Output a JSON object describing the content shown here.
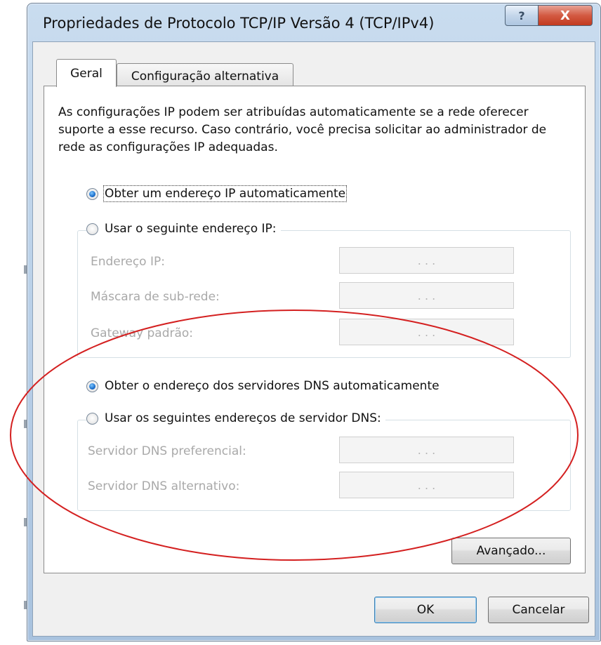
{
  "window": {
    "title": "Propriedades de Protocolo TCP/IP Versão 4 (TCP/IPv4)",
    "help_glyph": "?",
    "close_glyph": "X"
  },
  "tabs": [
    {
      "label": "Geral",
      "selected": true
    },
    {
      "label": "Configuração alternativa",
      "selected": false
    }
  ],
  "intro_text": "As configurações IP podem ser atribuídas automaticamente se a rede oferecer suporte a esse recurso. Caso contrário, você precisa solicitar ao administrador de rede as configurações IP adequadas.",
  "ip": {
    "auto_label": "Obter um endereço IP automaticamente",
    "auto_selected": true,
    "manual_label": "Usar o seguinte endereço IP:",
    "manual_selected": false,
    "fields": [
      {
        "label": "Endereço IP:",
        "value": ".   .   ."
      },
      {
        "label": "Máscara de sub-rede:",
        "value": ".   .   ."
      },
      {
        "label": "Gateway padrão:",
        "value": ".   .   ."
      }
    ]
  },
  "dns": {
    "auto_label": "Obter o endereço dos servidores DNS automaticamente",
    "auto_selected": true,
    "manual_label": "Usar os seguintes endereços de servidor DNS:",
    "manual_selected": false,
    "fields": [
      {
        "label": "Servidor DNS preferencial:",
        "value": ".   .   ."
      },
      {
        "label": "Servidor DNS alternativo:",
        "value": ".   .   ."
      }
    ]
  },
  "buttons": {
    "advanced": "Avançado...",
    "ok": "OK",
    "cancel": "Cancelar"
  },
  "colors": {
    "annotation_ellipse": "#d42020",
    "radio_selected": "#1b6fcc"
  }
}
